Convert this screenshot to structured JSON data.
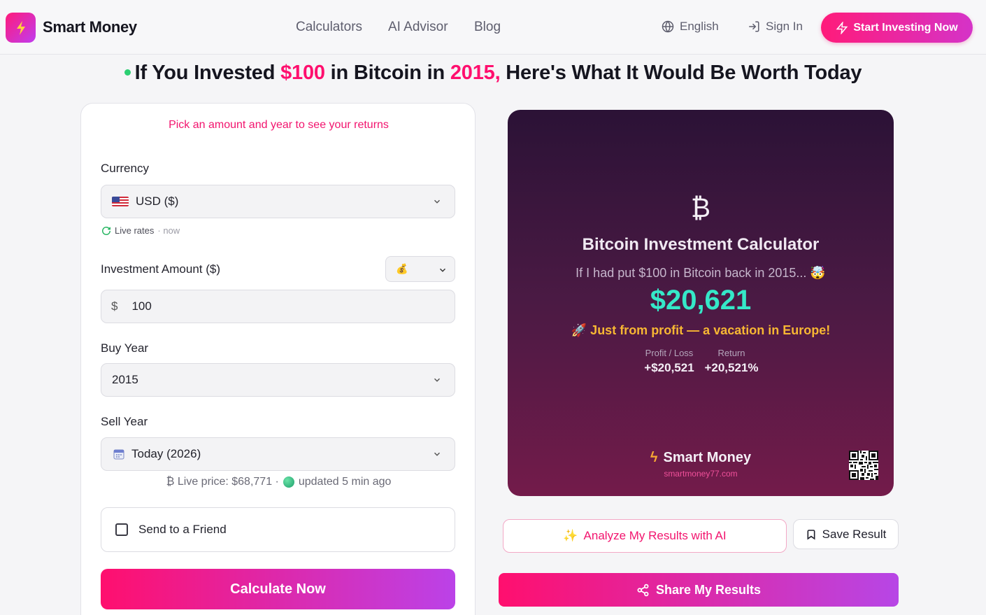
{
  "header": {
    "brand": "Smart Money",
    "nav": [
      "Calculators",
      "AI Advisor",
      "Blog"
    ],
    "language": "English",
    "sign_in": "Sign In",
    "cta": "Start Investing Now"
  },
  "headline": {
    "part1": "If You Invested ",
    "amount": "$100",
    "part2": " in Bitcoin in ",
    "year": "2015,",
    "part3": " Here's What It Would Be Worth Today"
  },
  "form": {
    "intro": "Pick an amount and year to see your returns",
    "currency_label": "Currency",
    "currency_value": "USD ($)",
    "live_rates": "Live rates",
    "live_rates_sub": "· now",
    "amount_label": "Investment Amount ($)",
    "amount_prefix": "$",
    "amount_value": "100",
    "buy_year_label": "Buy Year",
    "buy_year_value": "2015",
    "sell_year_label": "Sell Year",
    "sell_year_value": "Today (2026)",
    "live_price": "₿ Live price: $68,771 ·",
    "updated": "updated 5 min ago",
    "send_friend": "Send to a Friend",
    "calculate": "Calculate Now"
  },
  "result": {
    "symbol": "₿",
    "title": "Bitcoin Investment Calculator",
    "subtitle": "If I had put $100 in Bitcoin back in 2015... 🤯",
    "value": "$20,621",
    "tagline": "🚀 Just from profit — a vacation in Europe!",
    "profit_label": "Profit / Loss",
    "profit_value": "+$20,521",
    "return_label": "Return",
    "return_value": "+20,521%",
    "brand": "Smart Money",
    "url": "smartmoney77.com"
  },
  "actions": {
    "analyze": "Analyze My Results with AI",
    "save": "Save Result",
    "share": "Share My Results"
  },
  "colors": {
    "accent": "#ff0f6e",
    "accent_purple": "#bb42e8",
    "result_value": "#35e8c8",
    "tag_yellow": "#f7b733"
  }
}
